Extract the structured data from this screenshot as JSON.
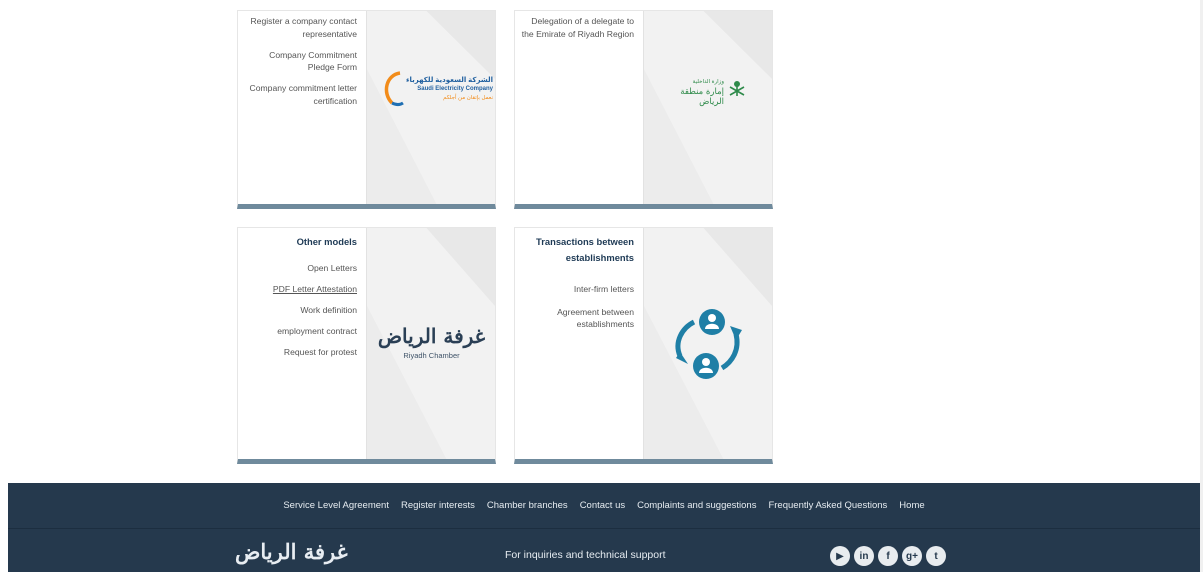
{
  "cards": {
    "sec": {
      "items": [
        "Register a company contact representative",
        "Company Commitment Pledge Form",
        "Company commitment letter certification"
      ],
      "logo_arabic": "الشركة السعودية للكهرباء",
      "logo_english": "Saudi Electricity Company",
      "logo_tagline": "نعمل بإتقان من أجلكم"
    },
    "emirate": {
      "items": [
        "Delegation of a delegate to the Emirate of Riyadh Region"
      ],
      "logo_arabic_small": "وزارة الداخلية",
      "logo_arabic": "إمارة منطقة الرياض"
    },
    "other_models": {
      "title": "Other models",
      "items": [
        "Open Letters",
        "PDF Letter Attestation",
        "Work definition",
        "employment contract",
        "Request for protest"
      ],
      "logo_arabic": "غرفة الرياض",
      "logo_english": "Riyadh Chamber"
    },
    "transactions": {
      "title": "Transactions between establishments",
      "items": [
        "Inter-firm letters",
        "Agreement between establishments"
      ],
      "icon": "user-exchange-icon",
      "icon_color": "#1f7fa6"
    }
  },
  "footer": {
    "nav": [
      "Service Level Agreement",
      "Register interests",
      "Chamber branches",
      "Contact us",
      "Complaints and suggestions",
      "Frequently Asked Questions",
      "Home"
    ],
    "logo_arabic": "غرفة الرياض",
    "support_text": "For inquiries and technical support",
    "social": [
      {
        "icon": "youtube-icon",
        "glyph": "▶"
      },
      {
        "icon": "linkedin-icon",
        "glyph": "in"
      },
      {
        "icon": "facebook-icon",
        "glyph": "f"
      },
      {
        "icon": "googleplus-icon",
        "glyph": "g+"
      },
      {
        "icon": "twitter-icon",
        "glyph": "t"
      }
    ],
    "bg_color": "#25394d",
    "accent_bar_color": "#6f8a9c"
  }
}
